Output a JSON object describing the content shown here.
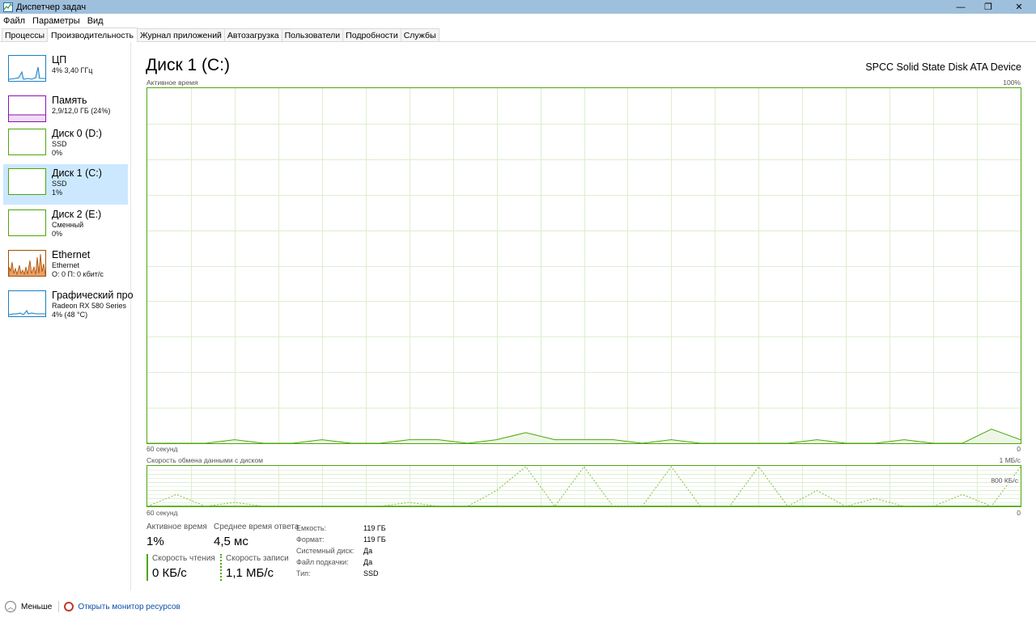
{
  "window": {
    "title": "Диспетчер задач",
    "minimize": "—",
    "maximize": "❐",
    "close": "✕"
  },
  "menu": [
    "Файл",
    "Параметры",
    "Вид"
  ],
  "tabs": [
    "Процессы",
    "Производительность",
    "Журнал приложений",
    "Автозагрузка",
    "Пользователи",
    "Подробности",
    "Службы"
  ],
  "active_tab": 1,
  "sidebar": [
    {
      "name": "ЦП",
      "sub1": "4% 3,40 ГГц",
      "sub2": "",
      "color": "#1a7fc4"
    },
    {
      "name": "Память",
      "sub1": "2,9/12,0 ГБ (24%)",
      "sub2": "",
      "color": "#8b12ae"
    },
    {
      "name": "Диск 0 (D:)",
      "sub1": "SSD",
      "sub2": "0%",
      "color": "#4da60c"
    },
    {
      "name": "Диск 1 (C:)",
      "sub1": "SSD",
      "sub2": "1%",
      "color": "#4da60c"
    },
    {
      "name": "Диск 2 (E:)",
      "sub1": "Сменный",
      "sub2": "0%",
      "color": "#4da60c"
    },
    {
      "name": "Ethernet",
      "sub1": "Ethernet",
      "sub2": "О: 0 П: 0 кбит/с",
      "color": "#a74f01"
    },
    {
      "name": "Графический про",
      "sub1": "Radeon RX 580 Series",
      "sub2": "4% (48 °C)",
      "color": "#1a7fc4"
    }
  ],
  "selected_item": 3,
  "main": {
    "title": "Диск 1 (C:)",
    "device": "SPCC Solid State Disk ATA Device",
    "graph1": {
      "label": "Активное время",
      "max": "100%",
      "time": "60 секунд",
      "min": "0"
    },
    "graph2": {
      "label": "Скорость обмена данными с диском",
      "max": "1 МБ/с",
      "mid": "800 КБ/с",
      "time": "60 секунд",
      "min": "0"
    }
  },
  "stats": {
    "active_time": {
      "label": "Активное время",
      "value": "1%"
    },
    "response": {
      "label": "Среднее время ответа",
      "value": "4,5 мс"
    },
    "read": {
      "label": "Скорость чтения",
      "value": "0 КБ/с"
    },
    "write": {
      "label": "Скорость записи",
      "value": "1,1 МБ/с"
    }
  },
  "info": [
    {
      "key": "Емкость:",
      "value": "119 ГБ"
    },
    {
      "key": "Формат:",
      "value": "119 ГБ"
    },
    {
      "key": "Системный диск:",
      "value": "Да"
    },
    {
      "key": "Файл подкачки:",
      "value": "Да"
    },
    {
      "key": "Тип:",
      "value": "SSD"
    }
  ],
  "footer": {
    "less": "Меньше",
    "monitor": "Открыть монитор ресурсов"
  },
  "chart_data": [
    {
      "type": "line",
      "title": "Активное время",
      "x": [
        60,
        58,
        56,
        54,
        52,
        50,
        48,
        46,
        44,
        42,
        40,
        38,
        36,
        34,
        32,
        30,
        28,
        26,
        24,
        22,
        20,
        18,
        16,
        14,
        12,
        10,
        8,
        6,
        4,
        2,
        0
      ],
      "series": [
        {
          "values": [
            0,
            0,
            0,
            1,
            0,
            0,
            1,
            0,
            0,
            1,
            1,
            0,
            1,
            3,
            1,
            1,
            1,
            0,
            1,
            0,
            0,
            0,
            0,
            1,
            0,
            0,
            1,
            0,
            0,
            4,
            1
          ]
        }
      ],
      "ylim": [
        0,
        100
      ],
      "xlabel": "60 секунд"
    },
    {
      "type": "line",
      "title": "Скорость обмена данными с диском",
      "x": [
        60,
        58,
        56,
        54,
        52,
        50,
        48,
        46,
        44,
        42,
        40,
        38,
        36,
        34,
        32,
        30,
        28,
        26,
        24,
        22,
        20,
        18,
        16,
        14,
        12,
        10,
        8,
        6,
        4,
        2,
        0
      ],
      "series": [
        {
          "values": [
            0,
            0,
            0,
            0,
            0,
            0,
            0,
            0,
            0,
            0,
            0,
            0,
            0,
            0,
            0,
            0,
            0,
            0,
            0,
            0,
            0,
            0,
            0,
            0,
            0,
            0,
            0,
            0,
            0,
            0,
            0
          ]
        },
        {
          "values": [
            0,
            300,
            0,
            100,
            0,
            0,
            0,
            0,
            0,
            100,
            0,
            0,
            400,
            1000,
            0,
            1000,
            0,
            0,
            1000,
            0,
            0,
            1000,
            0,
            400,
            0,
            200,
            0,
            0,
            300,
            0,
            1000
          ]
        }
      ],
      "ylim": [
        0,
        1000
      ],
      "ylabel": "1 МБ/с"
    }
  ]
}
